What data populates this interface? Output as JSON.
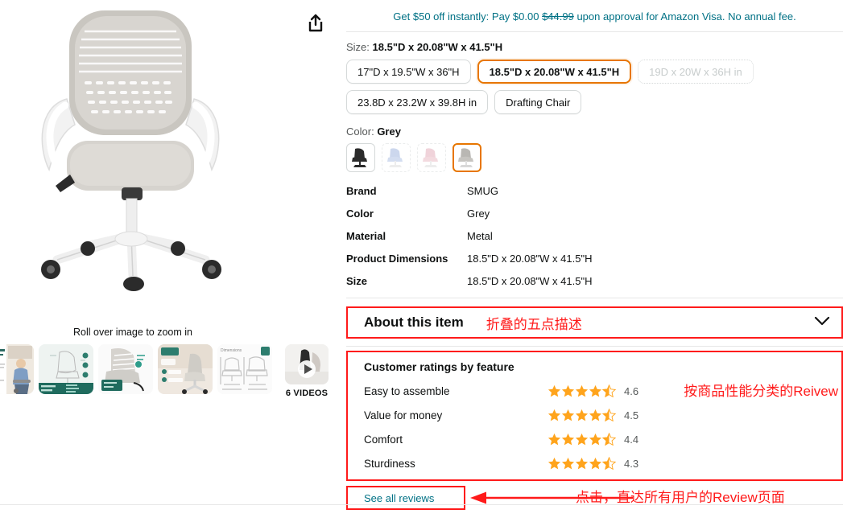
{
  "gallery": {
    "share_icon": "share-icon",
    "roll_over_hint": "Roll over image to zoom in",
    "main_image_alt": "SMUG grey mesh office chair with white frame",
    "thumbnails": [
      {
        "alt": "Woman sitting on chair lifestyle photo"
      },
      {
        "alt": "3 Points of Adjustment infographic"
      },
      {
        "alt": "Chair back mesh close-up infographic"
      },
      {
        "alt": "Chair in room lifestyle infographic"
      },
      {
        "alt": "Dimensions diagram"
      }
    ],
    "video": {
      "label": "6 VIDEOS",
      "play_icon": "play-icon"
    }
  },
  "promo": {
    "prefix": "Get $50 off instantly: Pay $0.00 ",
    "strike_price": "$44.99",
    "suffix": " upon approval for Amazon Visa. No annual fee."
  },
  "size": {
    "label": "Size:",
    "selected": "18.5\"D x 20.08\"W x 41.5\"H",
    "options": [
      {
        "label": "17\"D x 19.5\"W x 36\"H",
        "state": "normal"
      },
      {
        "label": "18.5\"D x 20.08\"W x 41.5\"H",
        "state": "selected"
      },
      {
        "label": "19D x 20W x 36H in",
        "state": "disabled"
      },
      {
        "label": "23.8D x 23.2W x 39.8H in",
        "state": "normal"
      },
      {
        "label": "Drafting Chair",
        "state": "normal"
      }
    ]
  },
  "color": {
    "label": "Color:",
    "selected": "Grey",
    "swatches": [
      {
        "name": "Black",
        "hex": "#2b2b2b",
        "state": "normal"
      },
      {
        "name": "Blue",
        "hex": "#8fa8d8",
        "state": "dim"
      },
      {
        "name": "Pink",
        "hex": "#e0a0ae",
        "state": "dim"
      },
      {
        "name": "Grey",
        "hex": "#b9b7b3",
        "state": "selected"
      }
    ]
  },
  "attributes": [
    {
      "key": "Brand",
      "value": "SMUG"
    },
    {
      "key": "Color",
      "value": "Grey"
    },
    {
      "key": "Material",
      "value": "Metal"
    },
    {
      "key": "Product Dimensions",
      "value": "18.5\"D x 20.08\"W x 41.5\"H"
    },
    {
      "key": "Size",
      "value": "18.5\"D x 20.08\"W x 41.5\"H"
    }
  ],
  "about": {
    "title": "About this item",
    "annotation": "折叠的五点描述",
    "chevron_icon": "chevron-down-icon"
  },
  "ratings": {
    "title": "Customer ratings by feature",
    "annotation": "按商品性能分类的Reivew",
    "rows": [
      {
        "name": "Easy to assemble",
        "value": "4.6",
        "stars": 4.5
      },
      {
        "name": "Value for money",
        "value": "4.5",
        "stars": 4.5
      },
      {
        "name": "Comfort",
        "value": "4.4",
        "stars": 4.5
      },
      {
        "name": "Sturdiness",
        "value": "4.3",
        "stars": 4.5
      }
    ]
  },
  "reviews": {
    "link_label": "See all reviews",
    "annotation": "点击，直达所有用户的Review页面"
  },
  "bottom": {
    "heading": ""
  },
  "colors": {
    "link_teal": "#007185",
    "annotation_red": "#ff1a1a",
    "selected_orange": "#e77600",
    "star_orange": "#ffa41c"
  }
}
